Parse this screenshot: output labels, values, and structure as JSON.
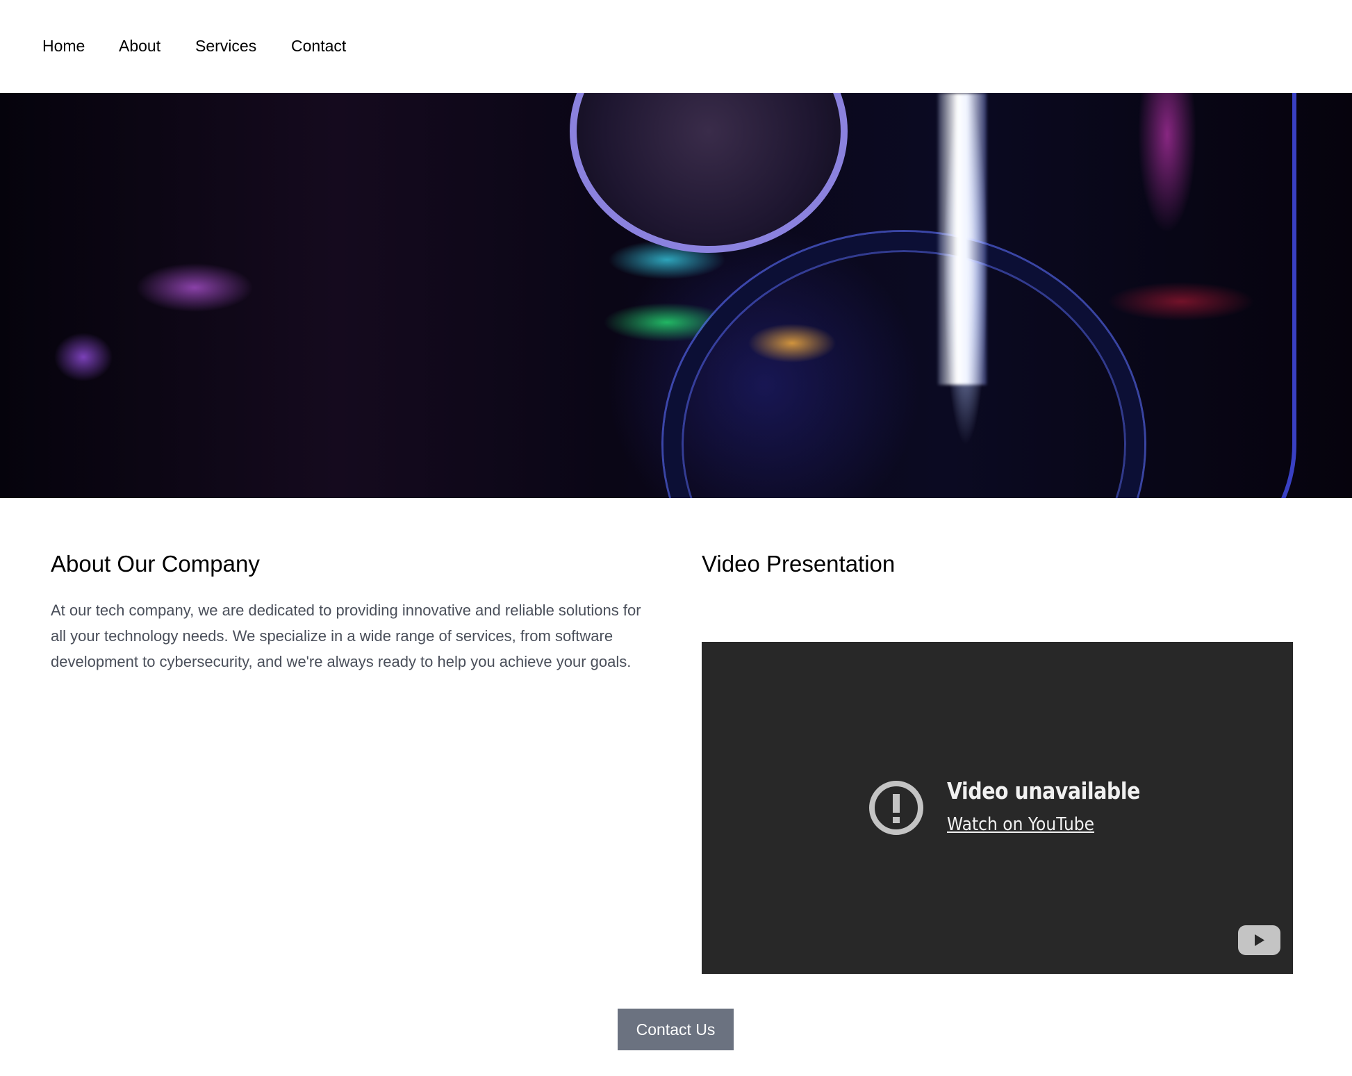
{
  "nav": {
    "items": [
      {
        "label": "Home"
      },
      {
        "label": "About"
      },
      {
        "label": "Services"
      },
      {
        "label": "Contact"
      }
    ]
  },
  "hero": {
    "image_description": "Close-up of RGB-lit PC internals with liquid cooling tubes"
  },
  "about": {
    "heading": "About Our Company",
    "body": "At our tech company, we are dedicated to providing innovative and reliable solutions for all your technology needs. We specialize in a wide range of services, from software development to cybersecurity, and we're always ready to help you achieve your goals."
  },
  "video": {
    "heading": "Video Presentation",
    "unavailable_title": "Video unavailable",
    "watch_link": "Watch on YouTube",
    "icon": "warning-circle-icon",
    "logo": "youtube-logo-icon"
  },
  "cta": {
    "label": "Contact Us",
    "color": "#6b7280"
  }
}
